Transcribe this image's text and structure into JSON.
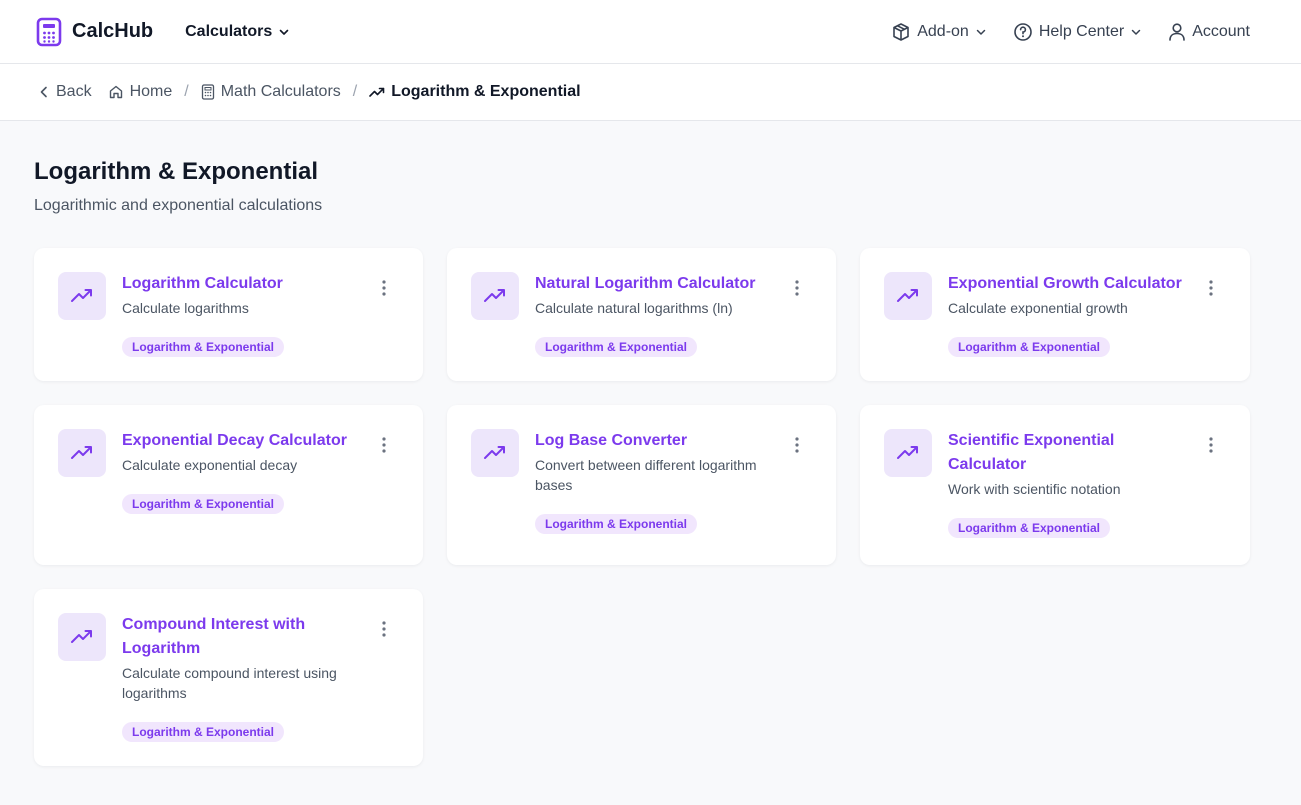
{
  "header": {
    "brand": "CalcHub",
    "calculators_label": "Calculators",
    "addon_label": "Add-on",
    "help_label": "Help Center",
    "account_label": "Account"
  },
  "breadcrumb": {
    "back": "Back",
    "home": "Home",
    "math": "Math Calculators",
    "current": "Logarithm & Exponential"
  },
  "page": {
    "title": "Logarithm & Exponential",
    "subtitle": "Logarithmic and exponential calculations"
  },
  "cards": [
    {
      "title": "Logarithm Calculator",
      "desc": "Calculate logarithms",
      "tag": "Logarithm & Exponential"
    },
    {
      "title": "Natural Logarithm Calculator",
      "desc": "Calculate natural logarithms (ln)",
      "tag": "Logarithm & Exponential"
    },
    {
      "title": "Exponential Growth Calculator",
      "desc": "Calculate exponential growth",
      "tag": "Logarithm & Exponential"
    },
    {
      "title": "Exponential Decay Calculator",
      "desc": "Calculate exponential decay",
      "tag": "Logarithm & Exponential"
    },
    {
      "title": "Log Base Converter",
      "desc": "Convert between different logarithm bases",
      "tag": "Logarithm & Exponential"
    },
    {
      "title": "Scientific Exponential Calculator",
      "desc": "Work with scientific notation",
      "tag": "Logarithm & Exponential"
    },
    {
      "title": "Compound Interest with Logarithm",
      "desc": "Calculate compound interest using logarithms",
      "tag": "Logarithm & Exponential"
    }
  ],
  "icons": {
    "brand": "calculator-icon",
    "card": "trending-up-icon",
    "menu": "more-vertical-icon"
  },
  "colors": {
    "accent": "#7c3aed",
    "tag_bg": "#f1e6fd",
    "icon_bg": "#ede6fb"
  }
}
